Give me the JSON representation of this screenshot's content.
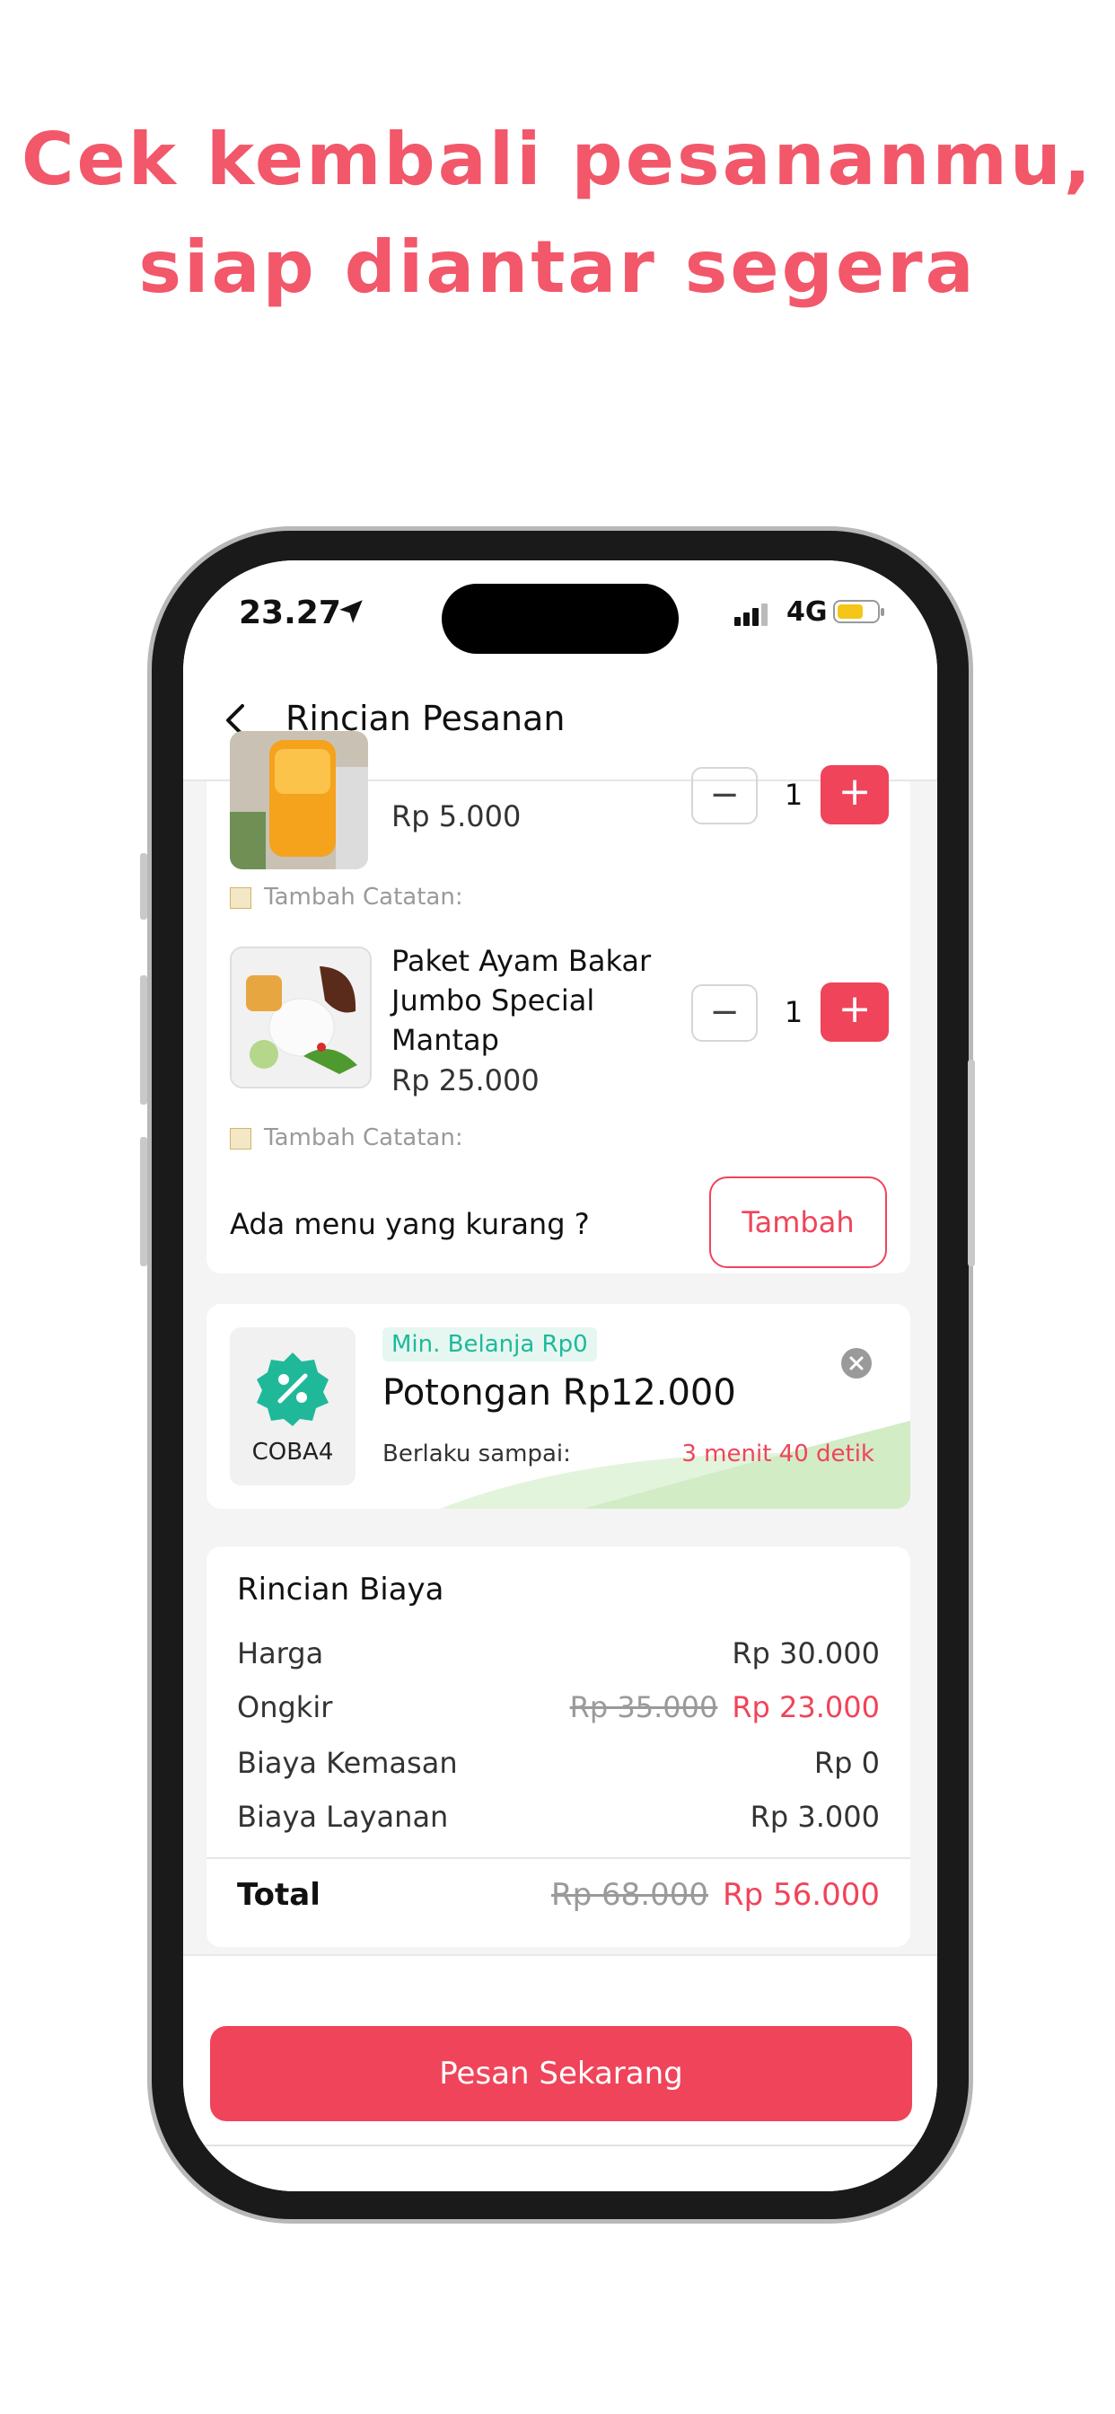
{
  "promo": {
    "line1": "Cek kembali pesananmu,",
    "line2": "siap diantar segera"
  },
  "status_bar": {
    "time": "23.27",
    "network": "4G",
    "location_icon": "location-arrow-icon",
    "battery_color": "#f5c518"
  },
  "header": {
    "title": "Rincian Pesanan",
    "back_icon": "chevron-left-icon"
  },
  "items": [
    {
      "name": "",
      "price": "Rp 5.000",
      "qty": "1",
      "note_label": "Tambah Catatan:"
    },
    {
      "name": "Paket Ayam Bakar Jumbo Special Mantap",
      "price": "Rp 25.000",
      "qty": "1",
      "note_label": "Tambah Catatan:"
    }
  ],
  "add_more": {
    "prompt": "Ada menu yang kurang ?",
    "button": "Tambah"
  },
  "voucher": {
    "code": "COBA4",
    "min_spend": "Min. Belanja Rp0",
    "title": "Potongan Rp12.000",
    "valid_label": "Berlaku sampai:",
    "countdown": "3 menit 40 detik",
    "icon": "discount-badge-icon",
    "close_icon": "close-circle-icon"
  },
  "costs": {
    "title": "Rincian Biaya",
    "rows": [
      {
        "label": "Harga",
        "value": "Rp 30.000"
      },
      {
        "label": "Ongkir",
        "old": "Rp 35.000",
        "value": "Rp 23.000"
      },
      {
        "label": "Biaya Kemasan",
        "value": "Rp 0"
      },
      {
        "label": "Biaya Layanan",
        "value": "Rp 3.000"
      }
    ],
    "total_label": "Total",
    "total_old": "Rp 68.000",
    "total_value": "Rp 56.000"
  },
  "cta": {
    "label": "Pesan Sekarang"
  },
  "colors": {
    "accent": "#f0445a",
    "promo_text": "#f2576a",
    "voucher_green": "#1fb99a"
  }
}
